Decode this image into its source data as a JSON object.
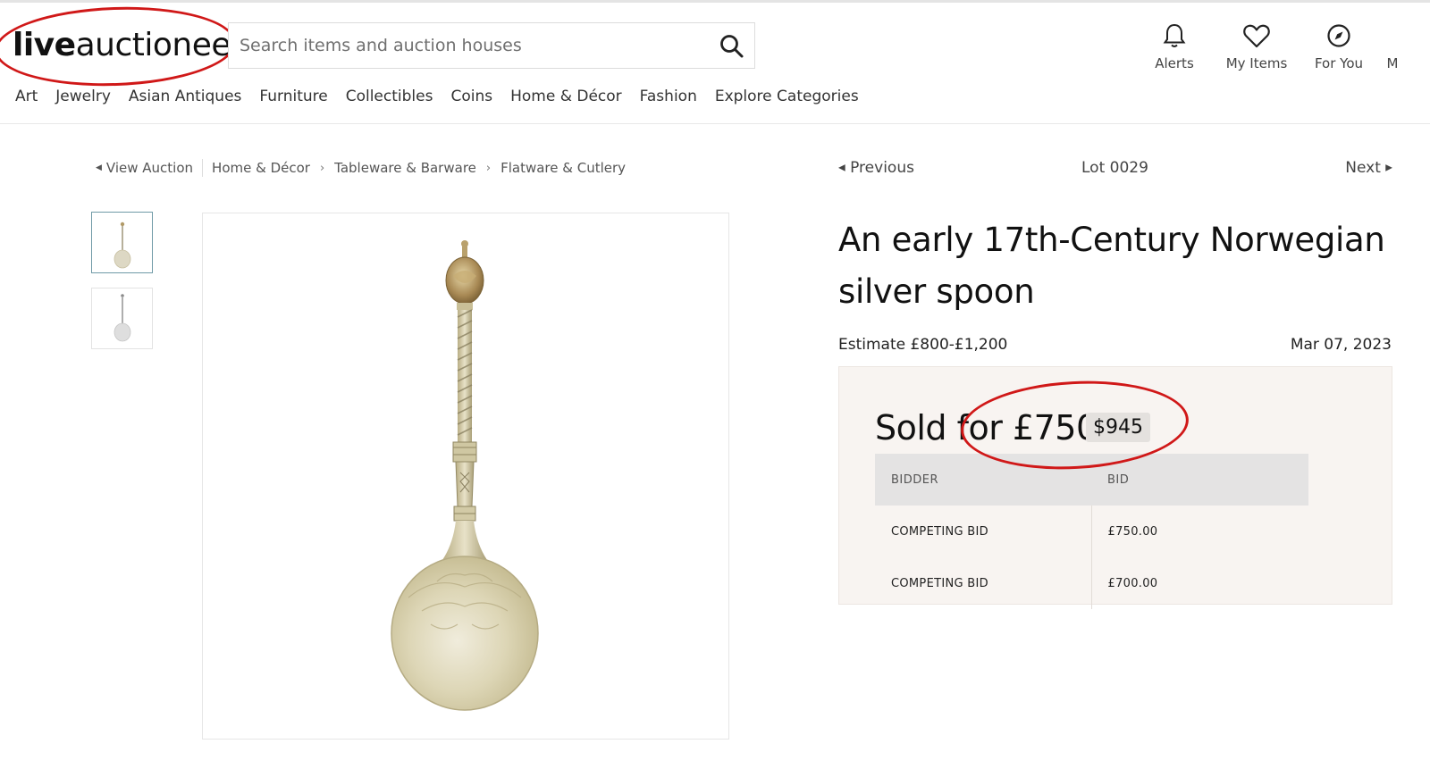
{
  "header": {
    "logo_bold": "live",
    "logo_regular": "auctioneers",
    "search_placeholder": "Search items and auction houses",
    "icons": [
      {
        "name": "bell-icon",
        "label": "Alerts"
      },
      {
        "name": "heart-icon",
        "label": "My Items"
      },
      {
        "name": "compass-icon",
        "label": "For You"
      },
      {
        "name": "more-icon",
        "label": "M"
      }
    ]
  },
  "nav": [
    "Art",
    "Jewelry",
    "Asian Antiques",
    "Furniture",
    "Collectibles",
    "Coins",
    "Home & Décor",
    "Fashion",
    "Explore Categories"
  ],
  "breadcrumb": {
    "back": "View Auction",
    "items": [
      "Home & Décor",
      "Tableware & Barware",
      "Flatware & Cutlery"
    ]
  },
  "lot_nav": {
    "previous": "Previous",
    "lot": "Lot 0029",
    "next": "Next"
  },
  "lot": {
    "title": "An early 17th-Century Norwegian silver spoon",
    "estimate": "Estimate £800-£1,200",
    "date": "Mar 07, 2023",
    "sold_text": "Sold for £750",
    "usd": "$945"
  },
  "bids": {
    "headers": [
      "BIDDER",
      "BID"
    ],
    "rows": [
      {
        "bidder": "COMPETING BID",
        "bid": "£750.00"
      },
      {
        "bidder": "COMPETING BID",
        "bid": "£700.00"
      }
    ]
  },
  "colors": {
    "annotation_red": "#d01818",
    "panel_bg": "#f8f4f1",
    "silver": "#d6cfa6"
  }
}
